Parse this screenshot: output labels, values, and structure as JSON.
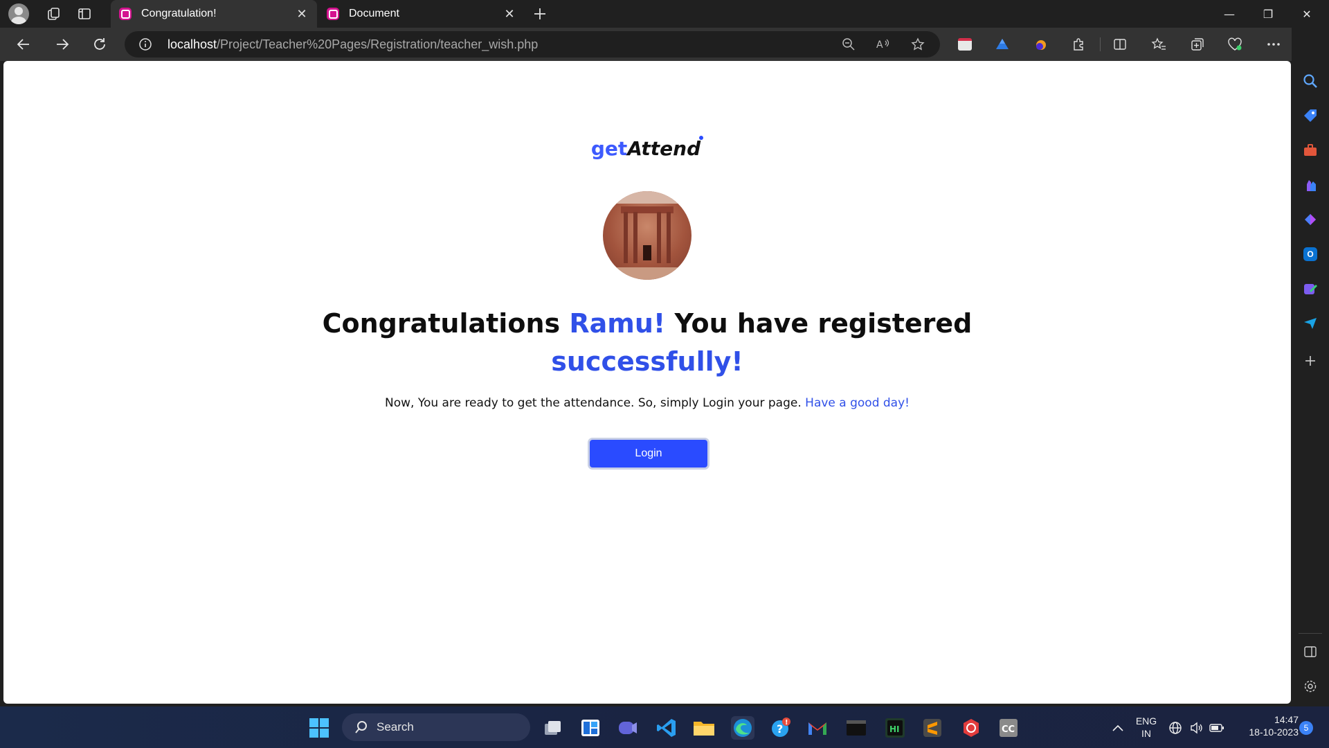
{
  "browser": {
    "tabs": [
      {
        "title": "Congratulation!",
        "active": true
      },
      {
        "title": "Document",
        "active": false
      }
    ],
    "address": {
      "host": "localhost",
      "path": "/Project/Teacher%20Pages/Registration/teacher_wish.php"
    },
    "window_controls": {
      "minimize": "—",
      "restore": "❐",
      "close": "✕"
    }
  },
  "page": {
    "brand": {
      "part1": "get",
      "part2": "Attend"
    },
    "headline": {
      "prefix": "Congratulations ",
      "name": "Ramu!",
      "middle": " You have registered ",
      "highlight": "successfully!"
    },
    "subtext": {
      "main": "Now, You are ready to get the attendance. So, simply Login your page. ",
      "highlight": "Have a good day!"
    },
    "login_button": "Login",
    "accent_color": "#2a4bff"
  },
  "taskbar": {
    "search_label": "Search",
    "language": {
      "line1": "ENG",
      "line2": "IN"
    },
    "time": "14:47",
    "date": "18-10-2023",
    "notification_count": "5"
  }
}
